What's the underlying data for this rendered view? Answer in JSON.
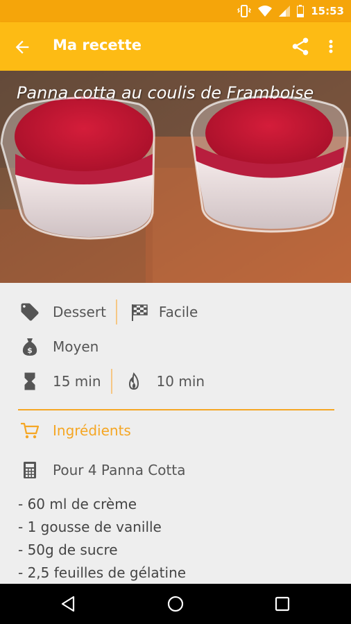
{
  "status_bar": {
    "time": "15:53",
    "icons": [
      "vibrate-icon",
      "wifi-icon",
      "cell-signal-icon",
      "battery-icon"
    ]
  },
  "app_bar": {
    "title": "Ma recette",
    "icons": [
      "back-arrow-icon",
      "share-icon",
      "more-vert-icon"
    ],
    "color": "#fdbb14"
  },
  "recipe": {
    "title": "Panna cotta au coulis de Framboise",
    "category": "Dessert",
    "difficulty": "Facile",
    "cost": "Moyen",
    "prep_time": "15 min",
    "cook_time": "10 min"
  },
  "ingredients": {
    "heading": "Ingrédients",
    "servings": "Pour 4 Panna Cotta",
    "items": [
      "- 60 ml de crème",
      "- 1 gousse de vanille",
      "- 50g de sucre",
      "- 2,5 feuilles de gélatine"
    ],
    "accent_color": "#f5a623"
  },
  "nav_bar": {
    "icons": [
      "back-triangle-icon",
      "home-circle-icon",
      "recents-square-icon"
    ]
  }
}
